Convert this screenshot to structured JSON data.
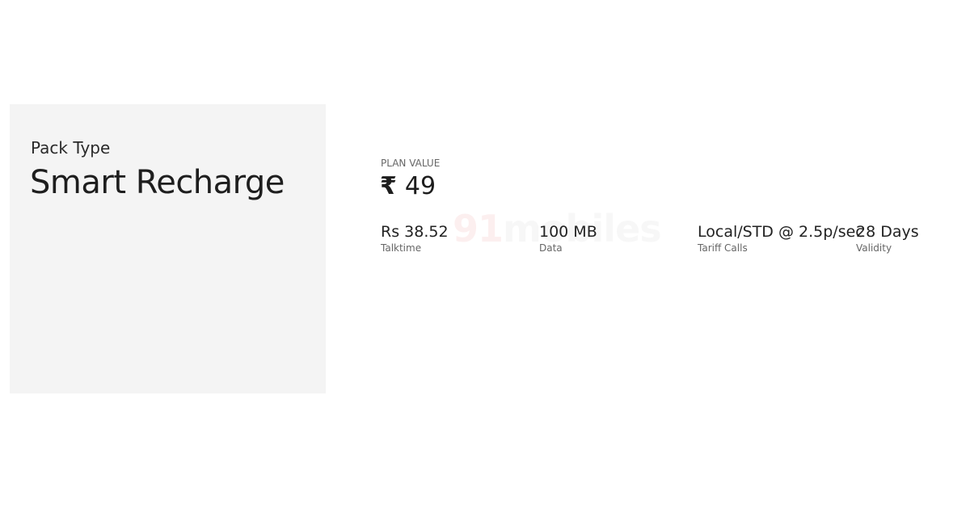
{
  "pack": {
    "type_label": "Pack Type",
    "type_value": "Smart Recharge"
  },
  "watermark": {
    "number": "91",
    "text": "mobiles"
  },
  "plan": {
    "value_label": "PLAN VALUE",
    "currency_symbol": "₹",
    "amount": "49"
  },
  "benefits": [
    {
      "value": "Rs 38.52",
      "label": "Talktime"
    },
    {
      "value": "100 MB",
      "label": "Data"
    },
    {
      "value": "Local/STD @ 2.5p/sec",
      "label": "Tariff Calls"
    },
    {
      "value": "28 Days",
      "label": "Validity"
    }
  ],
  "colors": {
    "card_background": "#f4f4f4",
    "primary_text": "#222222",
    "secondary_text": "#666666",
    "watermark_accent": "#e03030"
  }
}
